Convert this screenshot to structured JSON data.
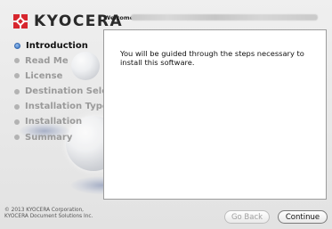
{
  "brand": {
    "name": "KYOCERA",
    "logo_icon": "kyocera-logo-icon",
    "logo_color": "#d7262e"
  },
  "header": {
    "label": "Welcome"
  },
  "steps": [
    {
      "label": "Introduction",
      "active": true
    },
    {
      "label": "Read Me",
      "active": false
    },
    {
      "label": "License",
      "active": false
    },
    {
      "label": "Destination Select",
      "active": false
    },
    {
      "label": "Installation Type",
      "active": false
    },
    {
      "label": "Installation",
      "active": false
    },
    {
      "label": "Summary",
      "active": false
    }
  ],
  "main": {
    "message": "You will be guided through the steps necessary to install this software."
  },
  "footer": {
    "copyright_line1": "© 2013 KYOCERA Corporation,",
    "copyright_line2": "KYOCERA Document Solutions Inc."
  },
  "buttons": {
    "back": "Go Back",
    "continue": "Continue"
  }
}
